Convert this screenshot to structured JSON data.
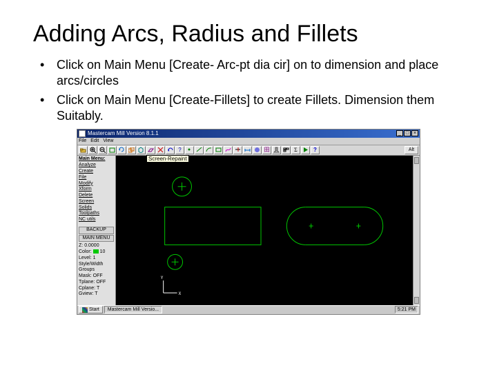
{
  "slide": {
    "title": "Adding Arcs, Radius and Fillets",
    "bullets": [
      "Click on Main Menu [Create- Arc-pt dia cir] on to dimension and place arcs/circles",
      "Click on Main Menu [Create-Fillets] to create Fillets. Dimension them Suitably."
    ]
  },
  "app": {
    "title": "Mastercam Mill Version 8.1.1",
    "menubar": [
      "File",
      "Edit",
      "View"
    ],
    "tooltip": "Screen-Repaint",
    "sidepanel": {
      "header": "Main Menu:",
      "items": [
        "Analyze",
        "Create",
        "File",
        "Modify",
        "Xform",
        "Delete",
        "Screen",
        "Solids",
        "Toolpaths",
        "NC utils"
      ],
      "backup": "BACKUP",
      "mainmenu": "MAIN MENU",
      "status": [
        {
          "k": "Z:",
          "v": "0.0000"
        },
        {
          "k": "Color:",
          "v": "10"
        },
        {
          "k": "Level:",
          "v": "1"
        },
        {
          "k": "Style/Width",
          "v": ""
        },
        {
          "k": "Groups",
          "v": ""
        },
        {
          "k": "Mask:",
          "v": "OFF"
        },
        {
          "k": "Tplane:",
          "v": "OFF"
        },
        {
          "k": "Cplane:",
          "v": "T"
        },
        {
          "k": "Gview:",
          "v": "T"
        }
      ]
    },
    "axis": {
      "y": "Y",
      "x": "X"
    },
    "taskbar": {
      "start": "Start",
      "item": "Mastercam Mill Versio...",
      "clock": "5:21 PM"
    }
  }
}
